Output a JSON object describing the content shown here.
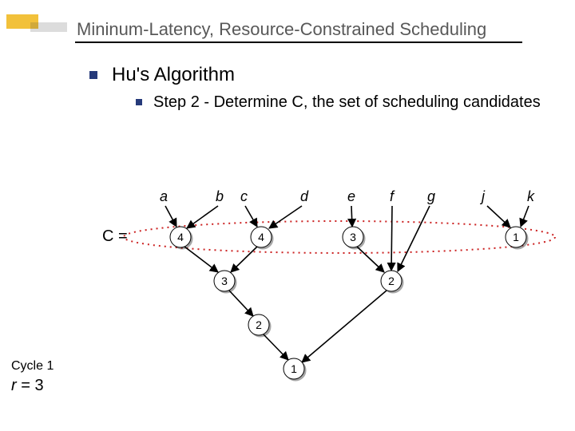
{
  "title": "Mininum-Latency, Resource-Constrained Scheduling",
  "h1": "Hu's Algorithm",
  "step": "Step 2 - Determine C, the set of scheduling candidates",
  "cycle_label": "Cycle 1",
  "r_html": "r = 3",
  "Clabel": "C =",
  "labels": {
    "a": "a",
    "b": "b",
    "c": "c",
    "d": "d",
    "e": "e",
    "f": "f",
    "g": "g",
    "j": "j",
    "k": "k"
  },
  "nodes": {
    "n1": "4",
    "n2": "4",
    "n3": "3",
    "n4": "1",
    "n5": "3",
    "n6": "2",
    "n7": "2",
    "n8": "1"
  }
}
